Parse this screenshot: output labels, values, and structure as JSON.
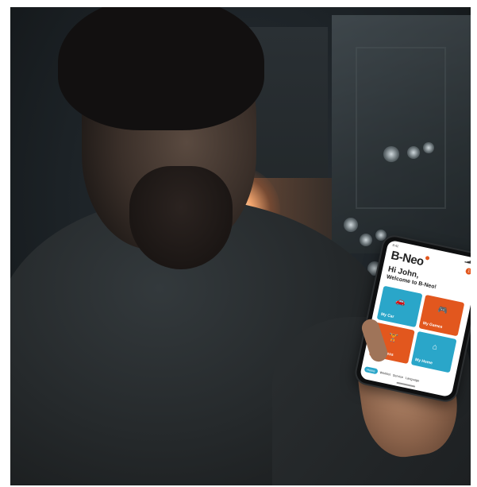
{
  "app": {
    "brand": "B-Neo",
    "greeting": "Hi John,",
    "welcome": "Welcome to B-Neo!",
    "notification_count": "1",
    "status_time": "9:41",
    "status_icons": "▂▄▆ ■",
    "tiles": [
      {
        "label": "My Car",
        "icon": "car-icon",
        "color": "#2aa6c9"
      },
      {
        "label": "My Games",
        "icon": "gamepad-icon",
        "color": "#e2571e"
      },
      {
        "label": "My Fitness",
        "icon": "fitness-icon",
        "color": "#e2571e"
      },
      {
        "label": "My Home",
        "icon": "home-icon",
        "color": "#2aa6c9"
      }
    ],
    "nav": [
      "Home",
      "Wishlist",
      "Service",
      "Language"
    ]
  },
  "colors": {
    "accent_orange": "#e2571e",
    "accent_blue": "#2aa6c9"
  }
}
